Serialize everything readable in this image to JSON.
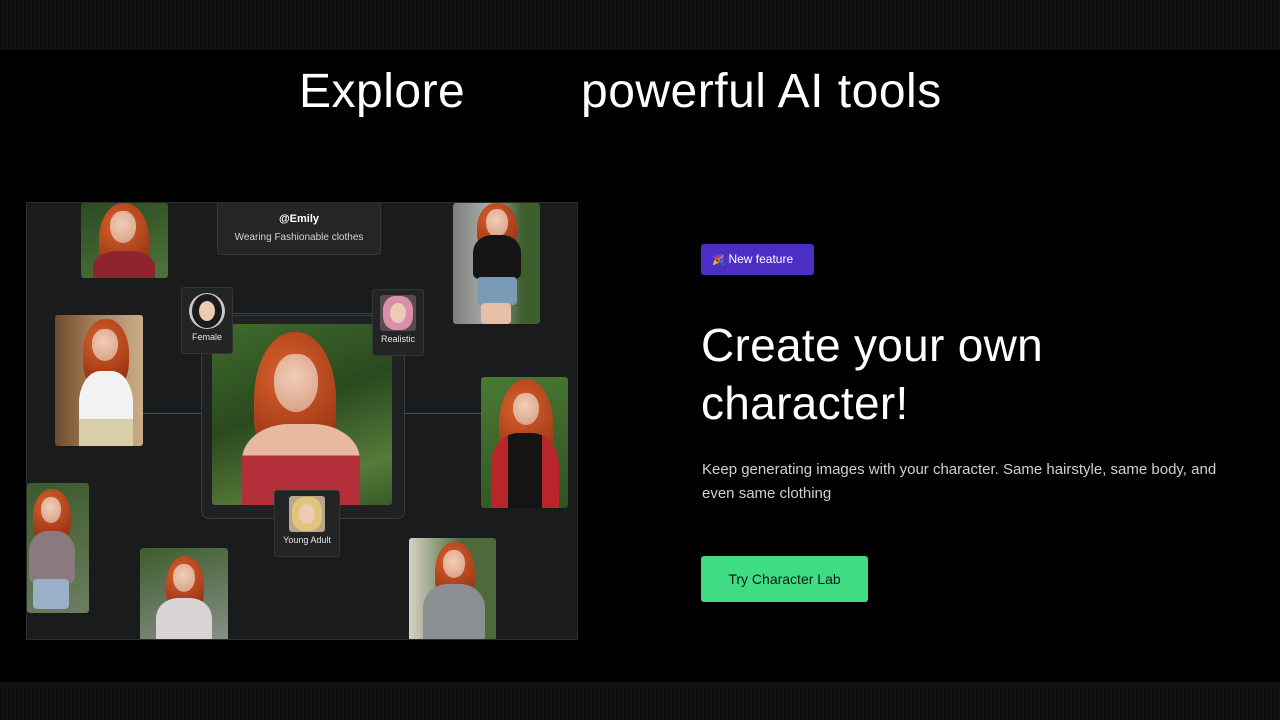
{
  "header": {
    "word_left": "Explore",
    "word_right": "powerful AI tools"
  },
  "collage": {
    "character_card": {
      "name": "@Emily",
      "description": "Wearing Fashionable clothes"
    },
    "chips": {
      "gender": "Female",
      "style": "Realistic",
      "age": "Young Adult"
    }
  },
  "feature": {
    "badge_icon": "🎉",
    "badge_label": "New feature",
    "title_line1": "Create your own",
    "title_line2": "character!",
    "description": "Keep generating images with your character. Same hairstyle, same body, and even same clothing",
    "cta_label": "Try Character Lab"
  },
  "colors": {
    "badge": "#4b2fc4",
    "cta": "#3fdc84",
    "background": "#000000"
  }
}
